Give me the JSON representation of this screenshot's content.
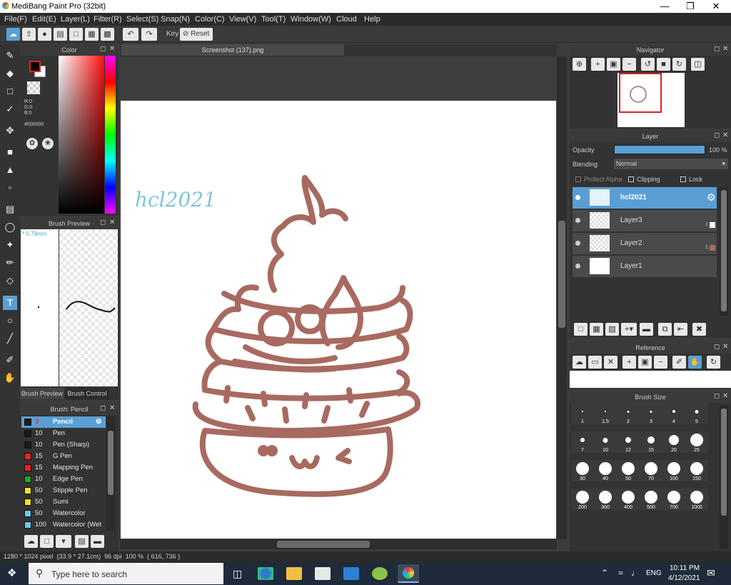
{
  "window": {
    "title": "MediBang Paint Pro (32bit)"
  },
  "menu": [
    "File(F)",
    "Edit(E)",
    "Layer(L)",
    "Filter(R)",
    "Select(S)",
    "Snap(N)",
    "Color(C)",
    "View(V)",
    "Tool(T)",
    "Window(W)",
    "Cloud",
    "Help"
  ],
  "toolbar": {
    "key_label": "Key",
    "reset_label": "Reset"
  },
  "color_panel": {
    "title": "Color",
    "r": "R:0",
    "g": "G:0",
    "b": "B:0",
    "hex": "#000000"
  },
  "brush_preview": {
    "title": "Brush Preview",
    "size": "* 0.79mm",
    "tab1": "Brush Preview",
    "tab2": "Brush Control"
  },
  "brush_list": {
    "title": "Brush: Pencil",
    "items": [
      {
        "size": "3",
        "name": "Pencil",
        "color": "#1a1a1a"
      },
      {
        "size": "10",
        "name": "Pen",
        "color": "#1a1a1a"
      },
      {
        "size": "10",
        "name": "Pen (Sharp)",
        "color": "#1a1a1a"
      },
      {
        "size": "15",
        "name": "G Pen",
        "color": "#ee2222"
      },
      {
        "size": "15",
        "name": "Mapping Pen",
        "color": "#ee2222"
      },
      {
        "size": "10",
        "name": "Edge Pen",
        "color": "#22aa22"
      },
      {
        "size": "50",
        "name": "Stipple Pen",
        "color": "#f0e020"
      },
      {
        "size": "50",
        "name": "Sumi",
        "color": "#f0e020"
      },
      {
        "size": "50",
        "name": "Watercolor",
        "color": "#66ccee"
      },
      {
        "size": "100",
        "name": "Watercolor (Wet",
        "color": "#66ccee"
      }
    ]
  },
  "document": {
    "tab": "Screenshot (137).png",
    "watermark": "hcl2021"
  },
  "navigator": {
    "title": "Navigator"
  },
  "layer_panel": {
    "title": "Layer",
    "opacity_label": "Opacity",
    "opacity_value": "100 %",
    "opacity": 1.0,
    "blending_label": "Blending",
    "blending_value": "Normal",
    "protect_alpha": "Protect Alpha",
    "clipping": "Clipping",
    "lock": "Lock",
    "layers": [
      {
        "name": "hcl2021",
        "tag": ""
      },
      {
        "name": "Layer3",
        "tag": "1"
      },
      {
        "name": "Layer2",
        "tag": "1"
      },
      {
        "name": "Layer1",
        "tag": ""
      }
    ]
  },
  "reference": {
    "title": "Reference"
  },
  "brush_size": {
    "title": "Brush Size",
    "sizes": [
      "1",
      "1.5",
      "2",
      "3",
      "4",
      "5",
      "7",
      "10",
      "12",
      "15",
      "20",
      "25",
      "30",
      "40",
      "50",
      "70",
      "100",
      "150",
      "200",
      "300",
      "400",
      "500",
      "700",
      "1000"
    ]
  },
  "status": {
    "text": "1280 * 1024 pixel  (33.9 * 27.1cm)  96 dpi  100 %  ( 616, 736 )"
  },
  "taskbar": {
    "search_placeholder": "Type here to search",
    "lang": "ENG",
    "time": "10:11 PM",
    "date": "4/12/2021"
  },
  "colors": {
    "accent": "#5a9fd4",
    "stroke": "#a86a60",
    "watermark": "#7ec6dc"
  }
}
